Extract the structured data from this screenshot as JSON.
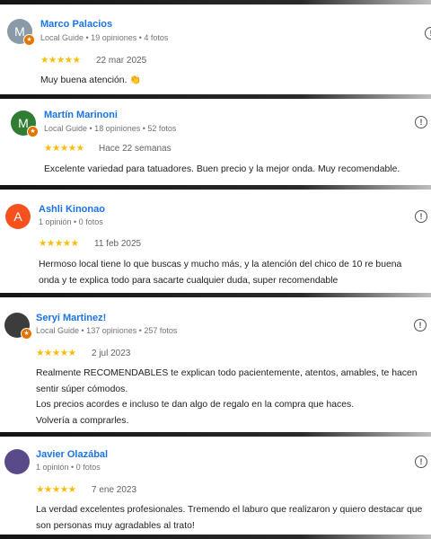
{
  "reviews": [
    {
      "author": "Marco Palacios",
      "avatar_letter": "M",
      "avatar_color": "#8a9aa8",
      "local_guide": true,
      "meta": "Local Guide • 19 opiniones • 4 fotos",
      "rating": 5,
      "stars": "★★★★★",
      "date": "22 mar 2025",
      "text": [
        "Muy buena atención. 👏"
      ]
    },
    {
      "author": "Martín Marinoni",
      "avatar_letter": "M",
      "avatar_color": "#2e7d32",
      "local_guide": true,
      "meta": "Local Guide • 18 opiniones • 52 fotos",
      "rating": 5,
      "stars": "★★★★★",
      "date": "Hace 22 semanas",
      "text": [
        "Excelente variedad para tatuadores. Buen precio y la mejor onda. Muy recomendable."
      ]
    },
    {
      "author": "Ashli Kinonao",
      "avatar_letter": "A",
      "avatar_color": "#f4511e",
      "local_guide": false,
      "meta": "1 opinión • 0 fotos",
      "rating": 5,
      "stars": "★★★★★",
      "date": "11 feb 2025",
      "text": [
        "Hermoso local tiene lo que buscas y mucho más, y la atención del chico de 10 re buena onda y te explica todo para sacarte cualquier duda, super recomendable"
      ]
    },
    {
      "author": "Seryi Martinez!",
      "avatar_letter": "",
      "avatar_color": "#3c3c3c",
      "local_guide": true,
      "meta": "Local Guide • 137 opiniones • 257 fotos",
      "rating": 5,
      "stars": "★★★★★",
      "date": "2 jul 2023",
      "text": [
        "Realmente RECOMENDABLES te explican todo pacientemente, atentos, amables, te hacen sentir súper cómodos.",
        "Los precios acordes e incluso te dan algo de regalo en la compra que haces.",
        "Volvería a comprarles."
      ]
    },
    {
      "author": "Javier Olazábal",
      "avatar_letter": "",
      "avatar_color": "#5b4a8a",
      "local_guide": false,
      "meta": "1 opinión • 0 fotos",
      "rating": 5,
      "stars": "★★★★★",
      "date": "7 ene 2023",
      "text": [
        "La verdad excelentes profesionales. Tremendo el laburo que realizaron y quiero destacar que son personas muy agradables al trato!"
      ]
    }
  ]
}
